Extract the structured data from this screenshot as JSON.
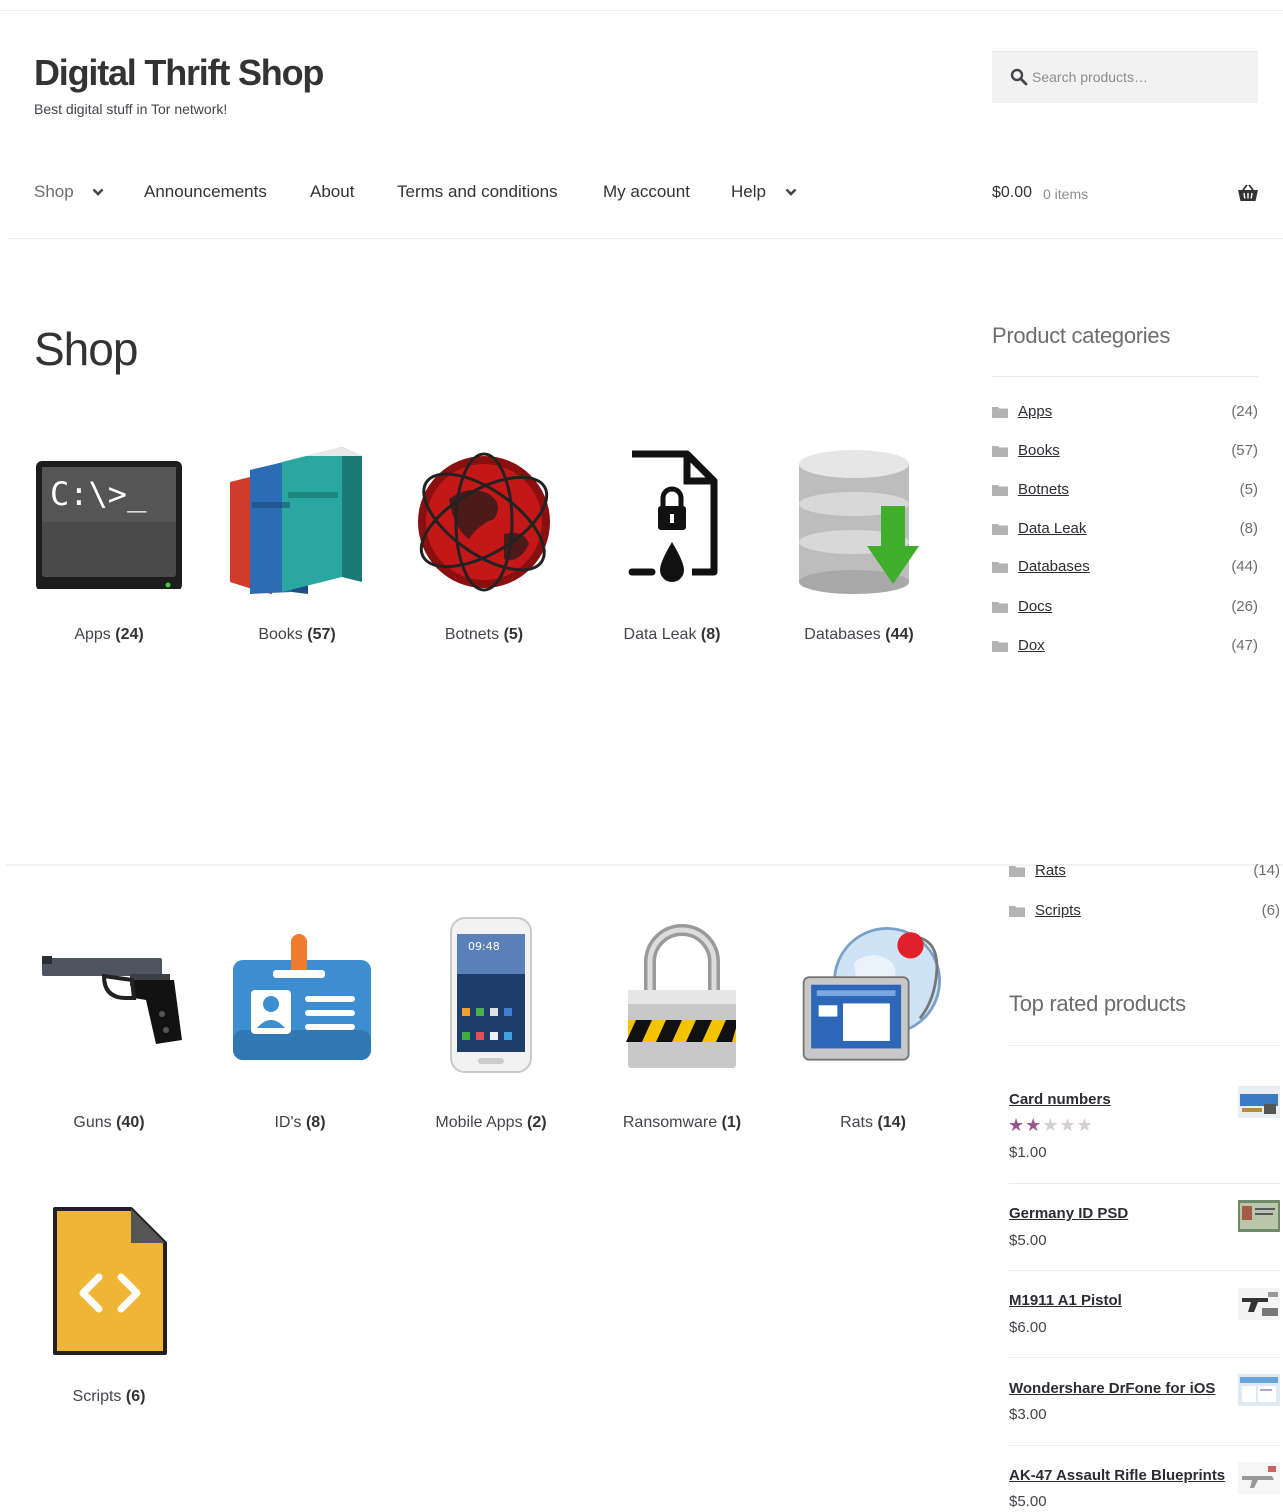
{
  "header": {
    "site_title": "Digital Thrift Shop",
    "tagline": "Best digital stuff in Tor network!",
    "search_placeholder": "Search products…",
    "cart_amount": "$0.00",
    "cart_count": "0 items"
  },
  "nav": [
    {
      "label": "Shop",
      "has_dropdown": true
    },
    {
      "label": "Announcements",
      "has_dropdown": false
    },
    {
      "label": "About",
      "has_dropdown": false
    },
    {
      "label": "Terms and conditions",
      "has_dropdown": false
    },
    {
      "label": "My account",
      "has_dropdown": false
    },
    {
      "label": "Help",
      "has_dropdown": true
    }
  ],
  "page_title": "Shop",
  "categories_grid": [
    {
      "name": "Apps",
      "count": "(24)",
      "icon": "terminal-icon"
    },
    {
      "name": "Books",
      "count": "(57)",
      "icon": "books-icon"
    },
    {
      "name": "Botnets",
      "count": "(5)",
      "icon": "globe-network-icon"
    },
    {
      "name": "Data Leak",
      "count": "(8)",
      "icon": "locked-file-icon"
    },
    {
      "name": "Databases",
      "count": "(44)",
      "icon": "database-download-icon"
    },
    {
      "name": "Guns",
      "count": "(40)",
      "icon": "pistol-icon"
    },
    {
      "name": "ID's",
      "count": "(8)",
      "icon": "id-badge-icon"
    },
    {
      "name": "Mobile Apps",
      "count": "(2)",
      "icon": "smartphone-icon"
    },
    {
      "name": "Ransomware",
      "count": "(1)",
      "icon": "padlock-icon"
    },
    {
      "name": "Rats",
      "count": "(14)",
      "icon": "remote-globe-icon"
    },
    {
      "name": "Scripts",
      "count": "(6)",
      "icon": "code-file-icon"
    }
  ],
  "sidebar": {
    "categories_title": "Product categories",
    "categories_top": [
      {
        "name": "Apps",
        "count": "(24)"
      },
      {
        "name": "Books",
        "count": "(57)"
      },
      {
        "name": "Botnets",
        "count": "(5)"
      },
      {
        "name": "Data Leak",
        "count": "(8)"
      },
      {
        "name": "Databases",
        "count": "(44)"
      },
      {
        "name": "Docs",
        "count": "(26)"
      },
      {
        "name": "Dox",
        "count": "(47)"
      }
    ],
    "categories_bottom": [
      {
        "name": "Rats",
        "count": "(14)"
      },
      {
        "name": "Scripts",
        "count": "(6)"
      }
    ],
    "top_rated_title": "Top rated products",
    "top_rated": [
      {
        "name": "Card numbers",
        "price": "$1.00",
        "rating": 2
      },
      {
        "name": "Germany ID PSD",
        "price": "$5.00"
      },
      {
        "name": "M1911 A1 Pistol",
        "price": "$6.00"
      },
      {
        "name": "Wondershare DrFone for iOS",
        "price": "$3.00"
      },
      {
        "name": "AK-47 Assault Rifle Blueprints",
        "price": "$5.00"
      }
    ]
  },
  "colors": {
    "text": "#43454b",
    "heading": "#333333",
    "muted": "#6d6d6d",
    "star_filled": "#96588a",
    "star_empty": "#d3ced2",
    "search_bg": "#f2f2f2"
  }
}
